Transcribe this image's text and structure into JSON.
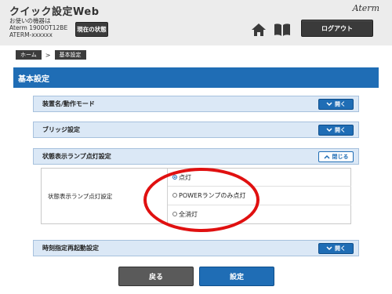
{
  "header": {
    "app_title": "クイック設定Web",
    "device_caption": "お使いの機器は",
    "device_model": "Aterm 1900OT12BE",
    "device_ssid": "ATERM-xxxxxx",
    "status_button": "現在の状態",
    "brand": "Aterm",
    "logout_button": "ログアウト"
  },
  "breadcrumb": {
    "home": "ホーム",
    "separator": ">",
    "current": "基本設定"
  },
  "page_title": "基本設定",
  "sections": {
    "device_mode": {
      "label": "装置名/動作モード",
      "toggle": "開く"
    },
    "bridge": {
      "label": "ブリッジ設定",
      "toggle": "開く"
    },
    "lamp": {
      "label": "状態表示ランプ点灯設定",
      "toggle": "閉じる"
    },
    "reboot": {
      "label": "時刻指定再起動設定",
      "toggle": "開く"
    }
  },
  "lamp_panel": {
    "field_label": "状態表示ランプ点灯設定",
    "options": [
      {
        "label": "点灯",
        "selected": true
      },
      {
        "label": "POWERランプのみ点灯",
        "selected": false
      },
      {
        "label": "全消灯",
        "selected": false
      }
    ]
  },
  "buttons": {
    "back": "戻る",
    "set": "設定"
  },
  "colors": {
    "primary_blue": "#1f6db5",
    "annotation_red": "#e01010",
    "section_bg": "#dbe8f6"
  }
}
